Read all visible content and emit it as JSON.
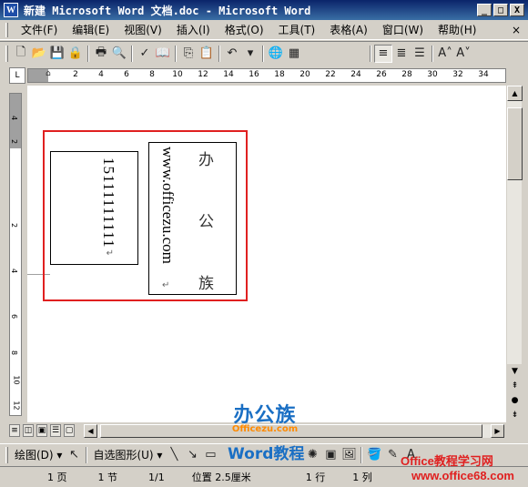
{
  "window": {
    "title": "新建 Microsoft Word 文档.doc - Microsoft Word",
    "app_icon": "W",
    "minimize": "_",
    "maximize": "□",
    "close": "X"
  },
  "menu": {
    "items": [
      "文件(F)",
      "编辑(E)",
      "视图(V)",
      "插入(I)",
      "格式(O)",
      "工具(T)",
      "表格(A)",
      "窗口(W)",
      "帮助(H)"
    ],
    "doc_close": "×"
  },
  "toolbar": {
    "buttons": [
      "new-icon",
      "open-icon",
      "save-icon",
      "permission-icon",
      "print-icon",
      "print-preview-icon",
      "spelling-icon",
      "research-icon",
      "copy-icon",
      "paste-icon",
      "undo-icon",
      "hyperlink-icon",
      "table-icon",
      "justify-left-icon",
      "center-icon",
      "justify-icon",
      "font-grow-icon",
      "font-shrink-icon"
    ]
  },
  "ruler": {
    "corner": "L",
    "ticks": [
      "2",
      "4",
      "6",
      "8",
      "10",
      "12",
      "14",
      "16",
      "18",
      "20",
      "22",
      "24",
      "26",
      "28",
      "30",
      "32",
      "34"
    ],
    "v_ticks": [
      "4",
      "2",
      "2",
      "4",
      "6",
      "8",
      "10",
      "12"
    ]
  },
  "document": {
    "textbox1": "15111111111",
    "textbox2_url": "www.officezu.com",
    "textbox2_chars": [
      "办",
      "公",
      "族"
    ],
    "paragraph_mark": "↵"
  },
  "watermark": {
    "title": "办公族",
    "subtitle": "Officezu.com",
    "word_label": "Word教程",
    "site1": "Office教程学习网",
    "site2": "www.office68.com"
  },
  "draw_toolbar": {
    "draw_label": "绘图(D) ▾",
    "autoshapes_label": "自选图形(U) ▾"
  },
  "status": {
    "page": "1 页",
    "section": "1 节",
    "pages": "1/1",
    "position": "位置 2.5厘米",
    "line": "1 行",
    "column": "1 列"
  }
}
